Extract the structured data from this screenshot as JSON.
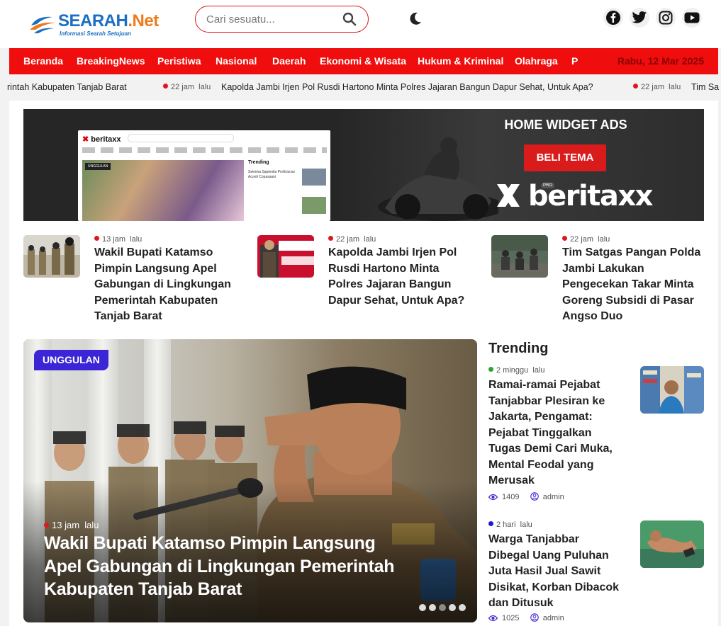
{
  "brand": {
    "name_main": "SEARAH",
    "name_suffix": ".Net",
    "tagline": "Informasi Searah Setujuan",
    "colors": {
      "primary": "#1a6fc4",
      "accent": "#ef7a1a",
      "nav": "#f00d0d"
    }
  },
  "search": {
    "placeholder": "Cari sesuatu..."
  },
  "theme_toggle": {
    "icon": "moon-icon"
  },
  "social": [
    {
      "name": "facebook-icon"
    },
    {
      "name": "twitter-icon"
    },
    {
      "name": "instagram-icon"
    },
    {
      "name": "youtube-icon"
    }
  ],
  "nav": {
    "items": [
      "Beranda",
      "BreakingNews",
      "Peristiwa",
      "Nasional",
      "Daerah",
      "Ekonomi & Wisata",
      "Hukum & Kriminal",
      "Olahraga",
      "P"
    ],
    "date": "Rabu, 12 Mar 2025"
  },
  "ticker": {
    "items": [
      {
        "title": "rintah Kabupaten Tanjab Barat"
      },
      {
        "time": "22 jam",
        "time_suffix": "lalu",
        "title": "Kapolda Jambi Irjen Pol Rusdi Hartono Minta Polres Jajaran Bangun Dapur Sehat, Untuk Apa?"
      },
      {
        "time": "22 jam",
        "time_suffix": "lalu",
        "title": "Tim Sa"
      }
    ]
  },
  "ad": {
    "heading": "HOME WIDGET ADS",
    "button": "BELI TEMA",
    "brand": "beritaxx",
    "brand_badge": "PRO",
    "preview": {
      "logo": "beritaxx",
      "badge": "UNGGULAN",
      "trending": "Trending",
      "item1": "Seinima Sapientia Proficisciur Aconti Copasauni"
    }
  },
  "news": [
    {
      "time": "13 jam",
      "time_suffix": "lalu",
      "title": "Wakil Bupati Katamso Pimpin Langsung Apel Gabungan di Lingkungan Pemerintah Kabupaten Tanjab Barat"
    },
    {
      "time": "22 jam",
      "time_suffix": "lalu",
      "title": "Kapolda Jambi Irjen Pol Rusdi Hartono Minta Polres Jajaran Bangun Dapur Sehat, Untuk Apa?"
    },
    {
      "time": "22 jam",
      "time_suffix": "lalu",
      "title": "Tim Satgas Pangan Polda Jambi Lakukan Pengecekan Takar Minta Goreng Subsidi di Pasar Angso Duo"
    }
  ],
  "hero": {
    "badge": "UNGGULAN",
    "time": "13 jam",
    "time_suffix": "lalu",
    "title": "Wakil Bupati Katamso Pimpin Langsung Apel Gabungan di Lingkungan Pemerintah Kabupaten Tanjab Barat",
    "slides": 5,
    "active_slide": 3
  },
  "trending": {
    "heading": "Trending",
    "items": [
      {
        "time": "2 minggu",
        "time_suffix": "lalu",
        "dot_color": "#2aa62a",
        "title": "Ramai-ramai Pejabat Tanjabbar Plesiran ke Jakarta, Pengamat: Pejabat Tinggalkan Tugas Demi Cari Muka, Mental Feodal yang Merusak",
        "views": "1409",
        "author": "admin"
      },
      {
        "time": "2 hari",
        "time_suffix": "lalu",
        "dot_color": "#1a1ad6",
        "title": "Warga Tanjabbar Dibegal Uang Puluhan Juta Hasil Jual Sawit Disikat, Korban Dibacok dan Ditusuk",
        "views": "1025",
        "author": "admin"
      }
    ]
  }
}
